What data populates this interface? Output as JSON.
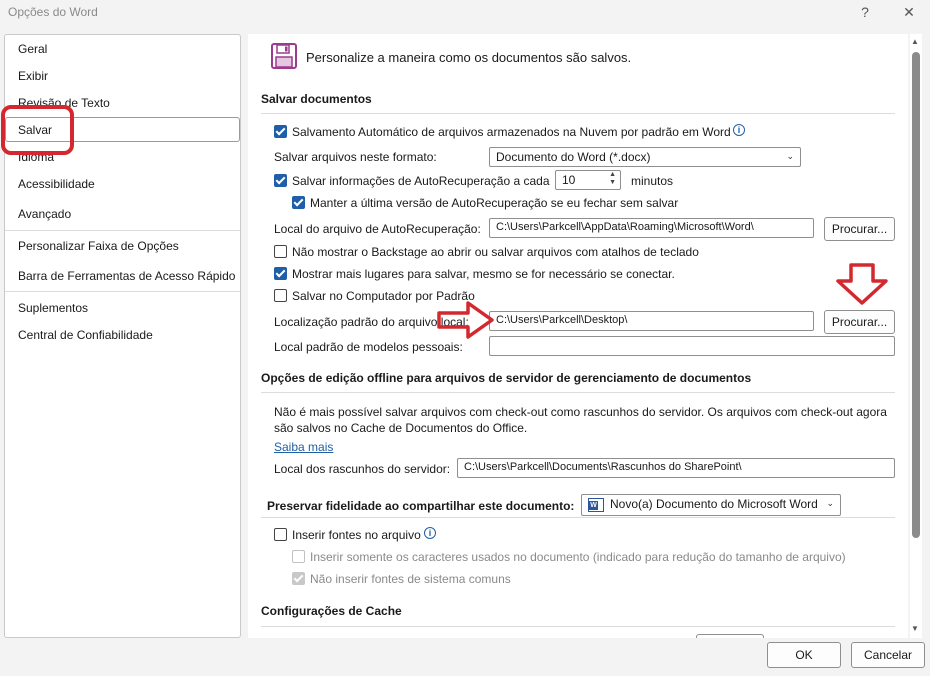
{
  "window": {
    "title": "Opções do Word",
    "help": "?",
    "close": "✕"
  },
  "nav": {
    "items": [
      {
        "label": "Geral"
      },
      {
        "label": "Exibir"
      },
      {
        "label": "Revisão de Texto"
      },
      {
        "label": "Salvar"
      },
      {
        "label": "Idioma"
      },
      {
        "label": "Acessibilidade"
      },
      {
        "label": "Avançado"
      },
      {
        "label": "Personalizar Faixa de Opções"
      },
      {
        "label": "Barra de Ferramentas de Acesso Rápido"
      },
      {
        "label": "Suplementos"
      },
      {
        "label": "Central de Confiabilidade"
      }
    ]
  },
  "header": {
    "title": "Personalize a maneira como os documentos são salvos.",
    "icon": "floppy-disk-icon"
  },
  "save_docs": {
    "heading": "Salvar documentos",
    "autosave_label": "Salvamento Automático de arquivos armazenados na Nuvem por padrão em Word",
    "format_label": "Salvar arquivos neste formato:",
    "format_value": "Documento do Word (*.docx)",
    "autorecover_label": "Salvar informações de AutoRecuperação a cada",
    "autorecover_minutes": "10",
    "minutes_label": "minutos",
    "keep_last_label": "Manter a última versão de AutoRecuperação se eu fechar sem salvar",
    "autorecover_location_label": "Local do arquivo de AutoRecuperação:",
    "autorecover_location_value": "C:\\Users\\Parkcell\\AppData\\Roaming\\Microsoft\\Word\\",
    "browse_label": "Procurar...",
    "no_backstage_label": "Não mostrar o Backstage ao abrir ou salvar arquivos com atalhos de teclado",
    "more_locations_label": "Mostrar mais lugares para salvar, mesmo se for necessário se conectar.",
    "save_computer_label": "Salvar no Computador por Padrão",
    "default_location_label": "Localização padrão do arquivo local:",
    "default_location_value": "C:\\Users\\Parkcell\\Desktop\\",
    "templates_label": "Local padrão de modelos pessoais:",
    "templates_value": ""
  },
  "offline": {
    "heading": "Opções de edição offline para arquivos de servidor de gerenciamento de documentos",
    "desc_line1": "Não é mais possível salvar arquivos com check-out como rascunhos do servidor. Os arquivos com check-out agora",
    "desc_line2": "são salvos no Cache de Documentos do Office.",
    "learn_more": "Saiba mais",
    "drafts_label": "Local dos rascunhos do servidor:",
    "drafts_value": "C:\\Users\\Parkcell\\Documents\\Rascunhos do SharePoint\\"
  },
  "fidelity": {
    "heading": "Preservar fidelidade ao compartilhar este documento:",
    "document_value": "Novo(a) Documento do Microsoft Word",
    "embed_fonts_label": "Inserir fontes no arquivo",
    "embed_chars_label": "Inserir somente os caracteres usados no documento (indicado para redução do tamanho de arquivo)",
    "no_common_fonts_label": "Não inserir fontes de sistema comuns"
  },
  "cache": {
    "heading": "Configurações de Cache"
  },
  "footer": {
    "ok_label": "OK",
    "cancel_label": "Cancelar"
  },
  "colors": {
    "accent": "#1e5fa8",
    "annotation_red": "#d3282f"
  }
}
